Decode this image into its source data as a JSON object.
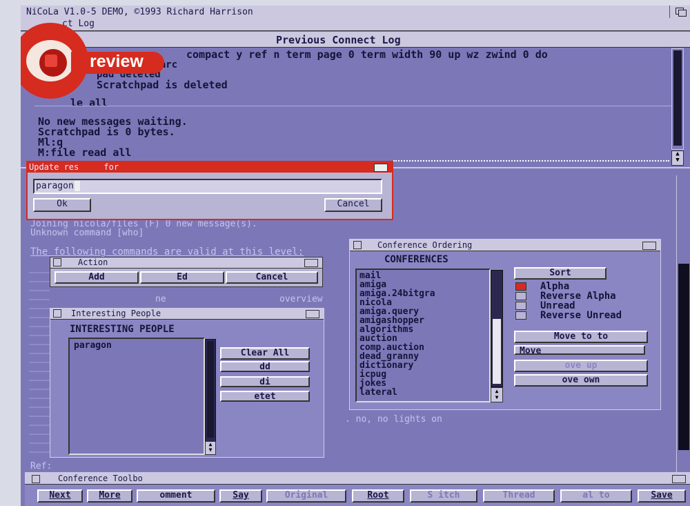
{
  "app": {
    "title": "NiCoLa V1.0-5 DEMO, ©1993 Richard Harrison",
    "connect_log_tab": "ct Log"
  },
  "badge": {
    "label": "review"
  },
  "log_window": {
    "title": "Previous Connect Log",
    "lines": [
      "compact y ref n term page 0 term width 90 up wz zwind 0 do",
      "llarc",
      "pad deleted",
      "Scratchpad is deleted",
      "le all",
      "",
      "No new messages waiting.",
      "Scratchpad is 0 bytes.",
      "Ml:q",
      "M:file read all"
    ]
  },
  "update_dialog": {
    "title": "Update res     for",
    "input_value": "paragon",
    "ok_label": "Ok",
    "cancel_label": "Cancel"
  },
  "background_text": {
    "line1": "Joining nicola/files (F) 0 new message(s).",
    "line2": "Unknown command [who]",
    "line3": "The following commands are valid at this level:",
    "word_overview": "overview",
    "word_ne": "ne",
    "bottom_text": ". no, no lights on",
    "ref_label": "Ref:"
  },
  "action_window": {
    "title": "Action",
    "add": "Add",
    "edit": "Ed",
    "cancel": "Cancel"
  },
  "people_window": {
    "title": "Interesting People",
    "heading": "INTERESTING PEOPLE",
    "items": [
      "paragon"
    ],
    "clear_all": "Clear All",
    "add": "dd",
    "edit": "di",
    "delete": "etet"
  },
  "conf_window": {
    "title": "Conference Ordering",
    "heading": "CONFERENCES",
    "items": [
      "mail",
      "amiga",
      "amiga.24bitgra",
      "nicola",
      "amiga.query",
      "amigashopper",
      "algorithms",
      "auction",
      "comp.auction",
      "dead_granny",
      "dictionary",
      "icpug",
      "jokes",
      "lateral"
    ],
    "sort_label": "Sort",
    "sort_options": [
      "Alpha",
      "Reverse Alpha",
      "Unread",
      "Reverse Unread"
    ],
    "move_top": "Move to to",
    "move_bottom": "Move",
    "move_up": "ove up",
    "move_down": "ove own"
  },
  "toolbox": {
    "title": "Conference Toolbo",
    "buttons": [
      "Next",
      "More",
      "omment",
      "Say",
      "Original",
      "Root",
      "S itch",
      "Thread",
      "al to",
      "Save"
    ]
  },
  "colors": {
    "screen": "#7c78b8",
    "titlebar": "#d6d4ea",
    "red": "#d62b1f",
    "button": "#b8b4d4"
  }
}
